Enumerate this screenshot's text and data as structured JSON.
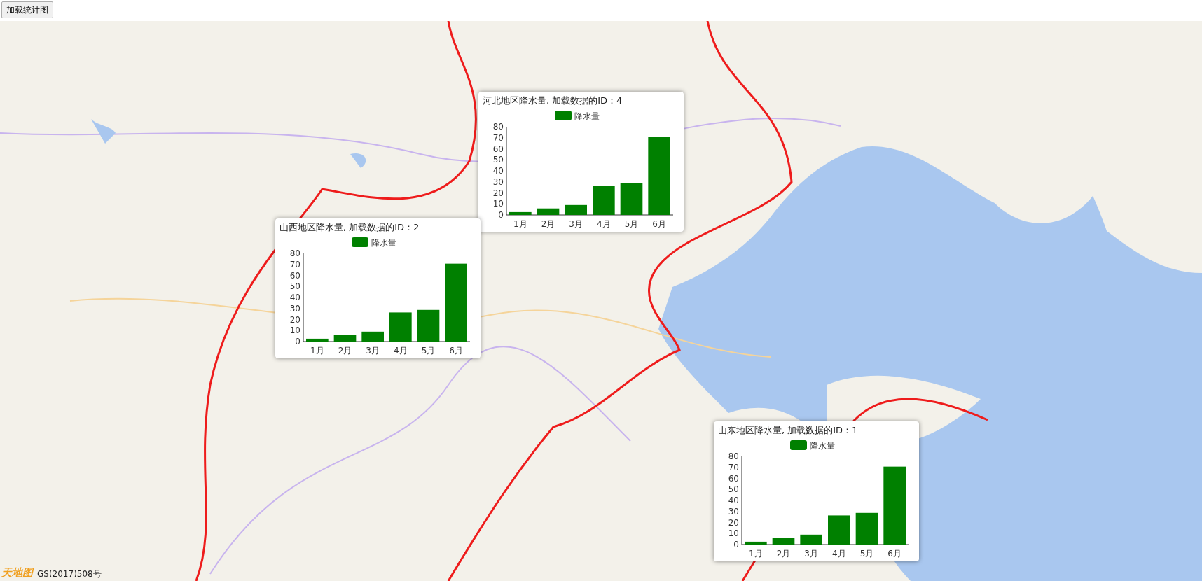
{
  "button": {
    "label": "加载统计图"
  },
  "popups": [
    {
      "title": "河北地区降水量, 加载数据的ID：4",
      "chart_data": {
        "type": "bar",
        "categories": [
          "1月",
          "2月",
          "3月",
          "4月",
          "5月",
          "6月"
        ],
        "series": [
          {
            "name": "降水量",
            "color": "#008000",
            "values": [
              2.6,
              5.9,
              9.0,
              26.4,
              28.7,
              70.7
            ]
          }
        ],
        "ylim": [
          0,
          80
        ],
        "yticks": [
          0,
          10,
          20,
          30,
          40,
          50,
          60,
          70,
          80
        ]
      }
    },
    {
      "title": "山西地区降水量, 加载数据的ID：2",
      "chart_data": {
        "type": "bar",
        "categories": [
          "1月",
          "2月",
          "3月",
          "4月",
          "5月",
          "6月"
        ],
        "series": [
          {
            "name": "降水量",
            "color": "#008000",
            "values": [
              2.6,
              5.9,
              9.0,
              26.4,
              28.7,
              70.7
            ]
          }
        ],
        "ylim": [
          0,
          80
        ],
        "yticks": [
          0,
          10,
          20,
          30,
          40,
          50,
          60,
          70,
          80
        ]
      }
    },
    {
      "title": "山东地区降水量, 加载数据的ID：1",
      "chart_data": {
        "type": "bar",
        "categories": [
          "1月",
          "2月",
          "3月",
          "4月",
          "5月",
          "6月"
        ],
        "series": [
          {
            "name": "降水量",
            "color": "#008000",
            "values": [
              2.6,
              5.9,
              9.0,
              26.4,
              28.7,
              70.7
            ]
          }
        ],
        "ylim": [
          0,
          80
        ],
        "yticks": [
          0,
          10,
          20,
          30,
          40,
          50,
          60,
          70,
          80
        ]
      }
    }
  ],
  "attribution": {
    "logo": "天地图",
    "license": "GS(2017)508号"
  }
}
